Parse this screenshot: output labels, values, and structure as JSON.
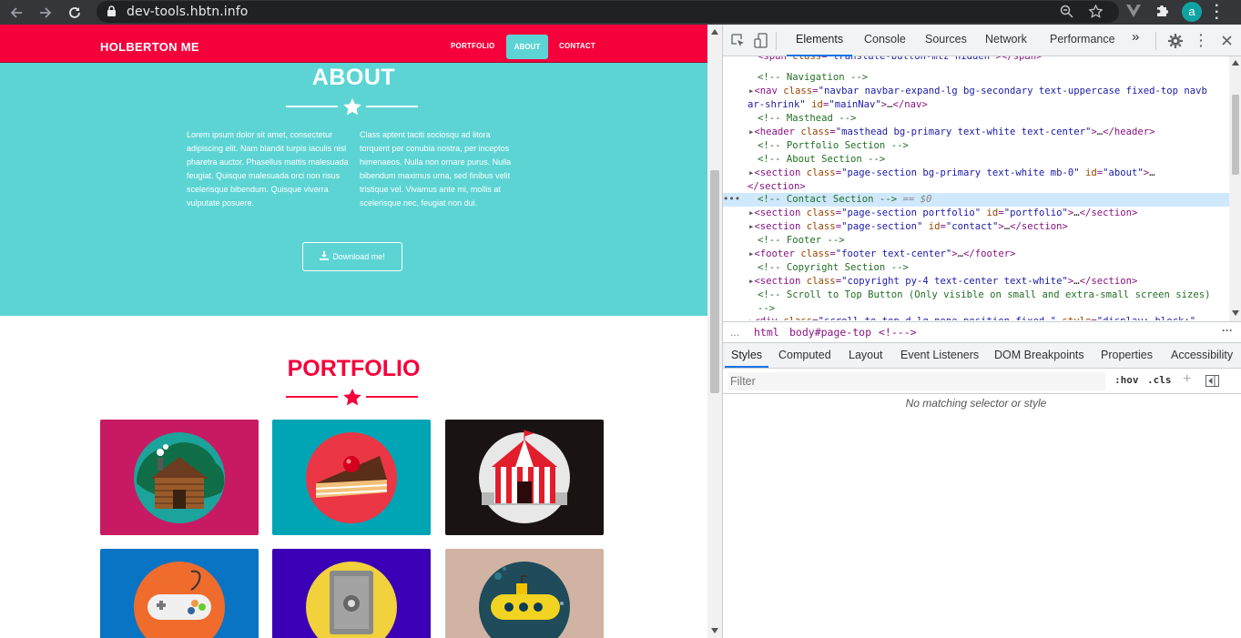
{
  "browser": {
    "url": "dev-tools.hbtn.info",
    "avatar_letter": "a"
  },
  "site": {
    "brand": "HOLBERTON ME",
    "nav": {
      "portfolio": "PORTFOLIO",
      "about": "ABOUT",
      "contact": "CONTACT"
    },
    "about": {
      "title": "ABOUT",
      "left_text": "Lorem ipsum dolor sit amet, consectetur adipiscing elit. Nam blandit turpis iaculis nisl pharetra auctor. Phasellus mattis malesuada feugiat. Quisque malesuada orci non risus scelerisque bibendum. Quisque viverra vulputate posuere.",
      "right_text": "Class aptent taciti sociosqu ad litora torquent per conubia nostra, per inceptos himenaeos. Nulla non ornare purus. Nulla bibendum maximus urna, sed finibus velit tristique vel. Vivamus ante mi, mollis at scelerisque nec, feugiat non dui.",
      "download_label": "Download me!"
    },
    "portfolio": {
      "title": "PORTFOLIO",
      "tiles": [
        {
          "name": "cabin",
          "bg": "#c81a63"
        },
        {
          "name": "cake",
          "bg": "#00a5b5"
        },
        {
          "name": "circus",
          "bg": "#1a1313"
        },
        {
          "name": "game-controller",
          "bg": "#0a74c4"
        },
        {
          "name": "safe",
          "bg": "#3b00b5"
        },
        {
          "name": "submarine",
          "bg": "#d1b3a4"
        }
      ]
    },
    "colors": {
      "primary": "#5dd4d4",
      "secondary": "#f6003c"
    }
  },
  "devtools": {
    "tabs": [
      "Elements",
      "Console",
      "Sources",
      "Network",
      "Performance"
    ],
    "more_tabs": "»",
    "breadcrumbs": [
      "...",
      "html",
      "body#page-top",
      "<!--->"
    ],
    "sub_tabs": [
      "Styles",
      "Computed",
      "Layout",
      "Event Listeners",
      "DOM Breakpoints",
      "Properties",
      "Accessibility"
    ],
    "filter_placeholder": "Filter",
    "hov": ":hov",
    "cls": ".cls",
    "no_match": "No matching selector or style",
    "selected_suffix": "== $0"
  }
}
